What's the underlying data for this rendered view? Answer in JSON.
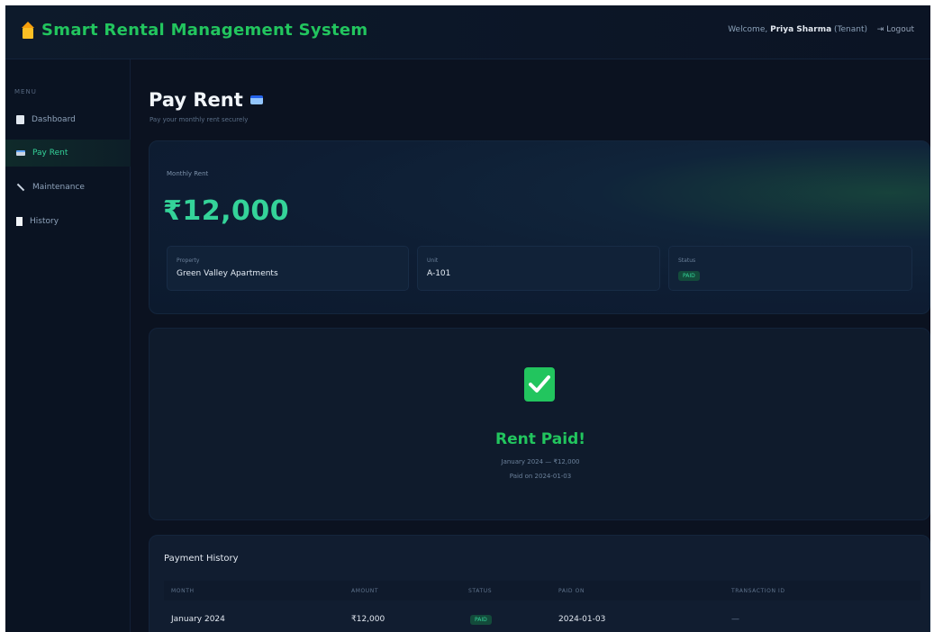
{
  "app": {
    "title": "Smart Rental Management System",
    "welcome_prefix": "Welcome,",
    "user_name": "Priya Sharma",
    "user_role": "(Tenant)",
    "logout_label": "⇥ Logout"
  },
  "sidebar": {
    "menu_heading": "MENU",
    "items": [
      {
        "label": "Dashboard",
        "icon": "clipboard-icon",
        "active": false
      },
      {
        "label": "Pay Rent",
        "icon": "credit-card-icon",
        "active": true
      },
      {
        "label": "Maintenance",
        "icon": "wrench-icon",
        "active": false
      },
      {
        "label": "History",
        "icon": "document-icon",
        "active": false
      }
    ]
  },
  "page": {
    "title": "Pay Rent",
    "subtitle": "Pay your monthly rent securely"
  },
  "rent": {
    "label": "Monthly Rent",
    "amount": "₹12,000",
    "property_label": "Property",
    "property_value": "Green Valley Apartments",
    "unit_label": "Unit",
    "unit_value": "A-101",
    "status_label": "Status",
    "status_value": "PAID"
  },
  "paid": {
    "title": "Rent Paid!",
    "line1": "January 2024 — ₹12,000",
    "line2": "Paid on 2024-01-03"
  },
  "history": {
    "title": "Payment History",
    "columns": [
      "MONTH",
      "AMOUNT",
      "STATUS",
      "PAID ON",
      "TRANSACTION ID"
    ],
    "rows": [
      {
        "month": "January 2024",
        "amount": "₹12,000",
        "status": "PAID",
        "paid_on": "2024-01-03",
        "transaction_id": "—"
      }
    ]
  },
  "colors": {
    "accent": "#22c55e",
    "background": "#0b1220",
    "card": "#0f1b2c"
  }
}
